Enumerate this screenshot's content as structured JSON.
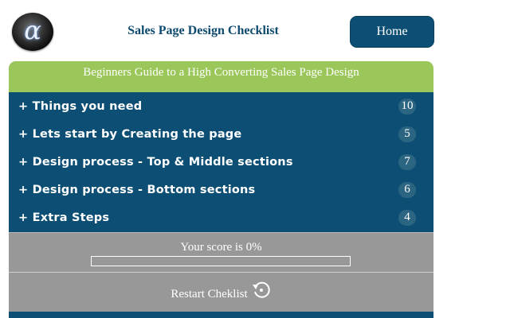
{
  "header": {
    "logo_icon": "alpha-logo-icon",
    "logo_glyph": "α",
    "title": "Sales Page Design Checklist",
    "home_label": "Home"
  },
  "banner": {
    "text": "Beginners Guide to a High Converting Sales Page Design"
  },
  "sections": [
    {
      "label": "+ Things you need",
      "count": "10"
    },
    {
      "label": "+ Lets start by Creating the page",
      "count": "5"
    },
    {
      "label": "+ Design process - Top & Middle sections",
      "count": "7"
    },
    {
      "label": "+ Design process - Bottom sections",
      "count": "6"
    },
    {
      "label": "+ Extra Steps",
      "count": "4"
    }
  ],
  "score": {
    "text": "Your score is 0%",
    "progress_percent": 0
  },
  "restart": {
    "label": "Restart Cheklist",
    "icon": "restart-icon"
  },
  "colors": {
    "primary": "#0d4f74",
    "accent_green": "#9bc75a",
    "grey_panel": "#989898",
    "badge": "#2c6582"
  }
}
